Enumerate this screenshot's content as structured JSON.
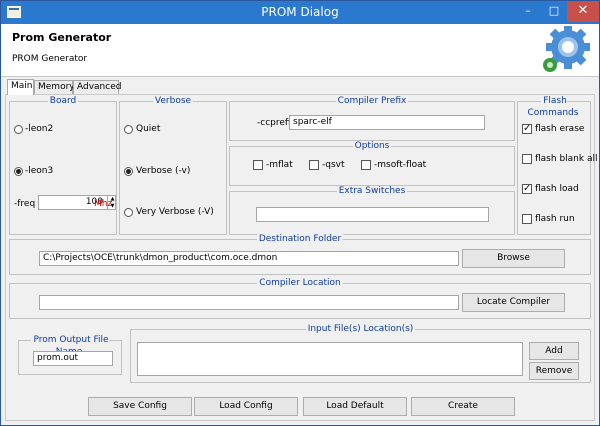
{
  "window": {
    "title": "PROM Dialog",
    "minimize": "–",
    "maximize": "□",
    "close": "✕"
  },
  "header": {
    "title": "Prom Generator",
    "subtitle": "PROM Generator",
    "logo_icon": "gear-settings-icon"
  },
  "tabs": [
    {
      "label": "Main",
      "active": true
    },
    {
      "label": "Memory",
      "active": false
    },
    {
      "label": "Advanced",
      "active": false
    }
  ],
  "board": {
    "title": "Board",
    "options": [
      "-leon2",
      "-leon3"
    ],
    "selected": "-leon3",
    "freq_label": "-freq",
    "freq_value": "100",
    "freq_unit": "Mhz"
  },
  "verbose": {
    "title": "Verbose",
    "options": [
      "Quiet",
      "Verbose (-v)",
      "Very Verbose (-V)"
    ],
    "selected": "Verbose (-v)"
  },
  "compiler_prefix": {
    "title": "Compiler Prefix",
    "label": "-ccprefix",
    "value": "sparc-elf"
  },
  "options": {
    "title": "Options",
    "items": [
      {
        "label": "-mflat",
        "checked": false
      },
      {
        "label": "-qsvt",
        "checked": false
      },
      {
        "label": "-msoft-float",
        "checked": false
      }
    ]
  },
  "extra_switches": {
    "title": "Extra Switches",
    "value": ""
  },
  "flash_commands": {
    "title": "Flash Commands",
    "items": [
      {
        "label": "flash erase",
        "checked": true
      },
      {
        "label": "flash blank all",
        "checked": false
      },
      {
        "label": "flash load",
        "checked": true
      },
      {
        "label": "flash run",
        "checked": false
      }
    ]
  },
  "destination_folder": {
    "title": "Destination Folder",
    "value": "C:\\Projects\\OCE\\trunk\\dmon_product\\com.oce.dmon",
    "button": "Browse"
  },
  "compiler_location": {
    "title": "Compiler Location",
    "value": "",
    "button": "Locate Compiler"
  },
  "prom_output": {
    "title": "Prom Output File Name",
    "value": "prom.out"
  },
  "input_files": {
    "title": "Input File(s) Location(s)",
    "add": "Add",
    "remove": "Remove"
  },
  "footer": {
    "save": "Save Config",
    "load": "Load Config",
    "load_default": "Load Default",
    "create": "Create"
  },
  "colors": {
    "titlebar": "#2b78cf",
    "group_title": "#0d3c9e",
    "close_button": "#c7504a",
    "freq_unit": "#c00000"
  }
}
